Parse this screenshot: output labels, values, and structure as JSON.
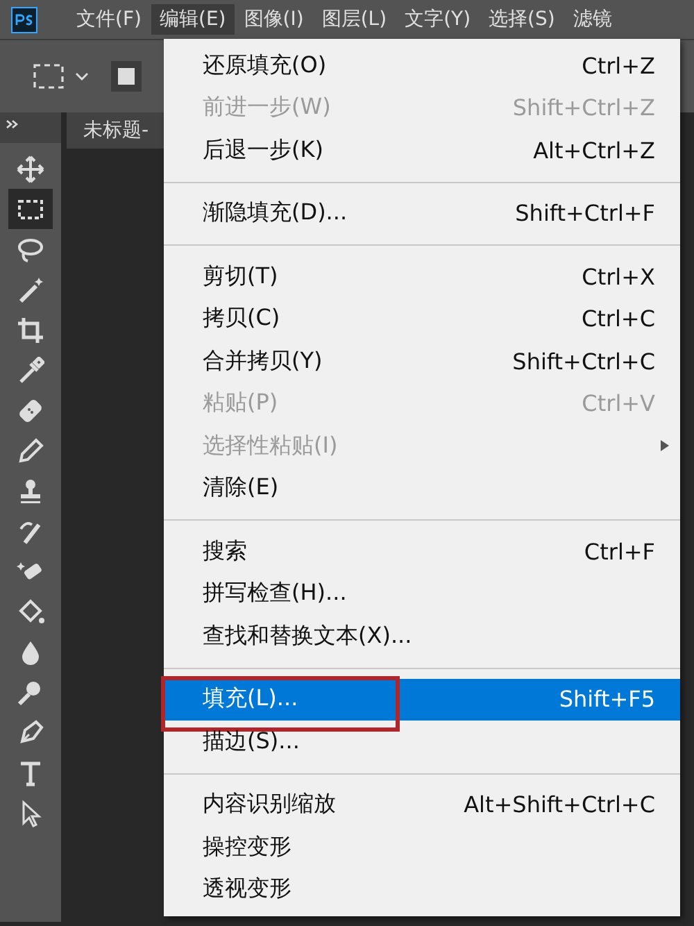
{
  "menubar": {
    "items": [
      {
        "label": "文件(F)",
        "selected": false
      },
      {
        "label": "编辑(E)",
        "selected": true
      },
      {
        "label": "图像(I)",
        "selected": false
      },
      {
        "label": "图层(L)",
        "selected": false
      },
      {
        "label": "文字(Y)",
        "selected": false
      },
      {
        "label": "选择(S)",
        "selected": false
      },
      {
        "label": "滤镜",
        "selected": false
      }
    ]
  },
  "document_tab": {
    "label": "未标题-"
  },
  "tools": [
    {
      "selected": false
    },
    {
      "selected": true
    },
    {
      "selected": false
    },
    {
      "selected": false
    },
    {
      "selected": false
    },
    {
      "selected": false
    },
    {
      "selected": false
    },
    {
      "selected": false
    },
    {
      "selected": false
    },
    {
      "selected": false
    },
    {
      "selected": false
    },
    {
      "selected": false
    },
    {
      "selected": false
    },
    {
      "selected": false
    },
    {
      "selected": false
    },
    {
      "selected": false
    },
    {
      "selected": false
    }
  ],
  "menu": {
    "groups": [
      [
        {
          "label": "还原填充(O)",
          "shortcut": "Ctrl+Z",
          "disabled": false,
          "selected": false
        },
        {
          "label": "前进一步(W)",
          "shortcut": "Shift+Ctrl+Z",
          "disabled": true,
          "selected": false
        },
        {
          "label": "后退一步(K)",
          "shortcut": "Alt+Ctrl+Z",
          "disabled": false,
          "selected": false
        }
      ],
      [
        {
          "label": "渐隐填充(D)...",
          "shortcut": "Shift+Ctrl+F",
          "disabled": false,
          "selected": false
        }
      ],
      [
        {
          "label": "剪切(T)",
          "shortcut": "Ctrl+X",
          "disabled": false,
          "selected": false
        },
        {
          "label": "拷贝(C)",
          "shortcut": "Ctrl+C",
          "disabled": false,
          "selected": false
        },
        {
          "label": "合并拷贝(Y)",
          "shortcut": "Shift+Ctrl+C",
          "disabled": false,
          "selected": false
        },
        {
          "label": "粘贴(P)",
          "shortcut": "Ctrl+V",
          "disabled": true,
          "selected": false
        },
        {
          "label": "选择性粘贴(I)",
          "disabled": true,
          "submenu": true,
          "selected": false
        },
        {
          "label": "清除(E)",
          "disabled": false,
          "selected": false
        }
      ],
      [
        {
          "label": "搜索",
          "shortcut": "Ctrl+F",
          "disabled": false,
          "selected": false
        },
        {
          "label": "拼写检查(H)...",
          "disabled": false,
          "selected": false
        },
        {
          "label": "查找和替换文本(X)...",
          "disabled": false,
          "selected": false
        }
      ],
      [
        {
          "label": "填充(L)...",
          "shortcut": "Shift+F5",
          "disabled": false,
          "selected": true,
          "framed": true
        },
        {
          "label": "描边(S)...",
          "disabled": false,
          "selected": false
        }
      ],
      [
        {
          "label": "内容识别缩放",
          "shortcut": "Alt+Shift+Ctrl+C",
          "disabled": false,
          "selected": false
        },
        {
          "label": "操控变形",
          "disabled": false,
          "selected": false
        },
        {
          "label": "透视变形",
          "disabled": false,
          "selected": false
        }
      ]
    ]
  }
}
